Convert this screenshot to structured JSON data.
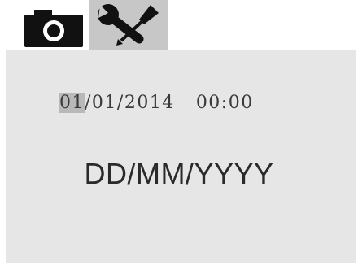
{
  "tabs": [
    {
      "icon": "camera-icon",
      "selected": false
    },
    {
      "icon": "wrench-screwdriver-icon",
      "selected": true
    }
  ],
  "datetime": {
    "day": "01",
    "month_year": "/01/2014",
    "time": "00:00"
  },
  "date_format": "DD/MM/YYYY",
  "colors": {
    "panel_bg": "#e6e6e6",
    "selected_tab_bg": "#c7c7c7",
    "highlight": "#b9b9b9"
  }
}
